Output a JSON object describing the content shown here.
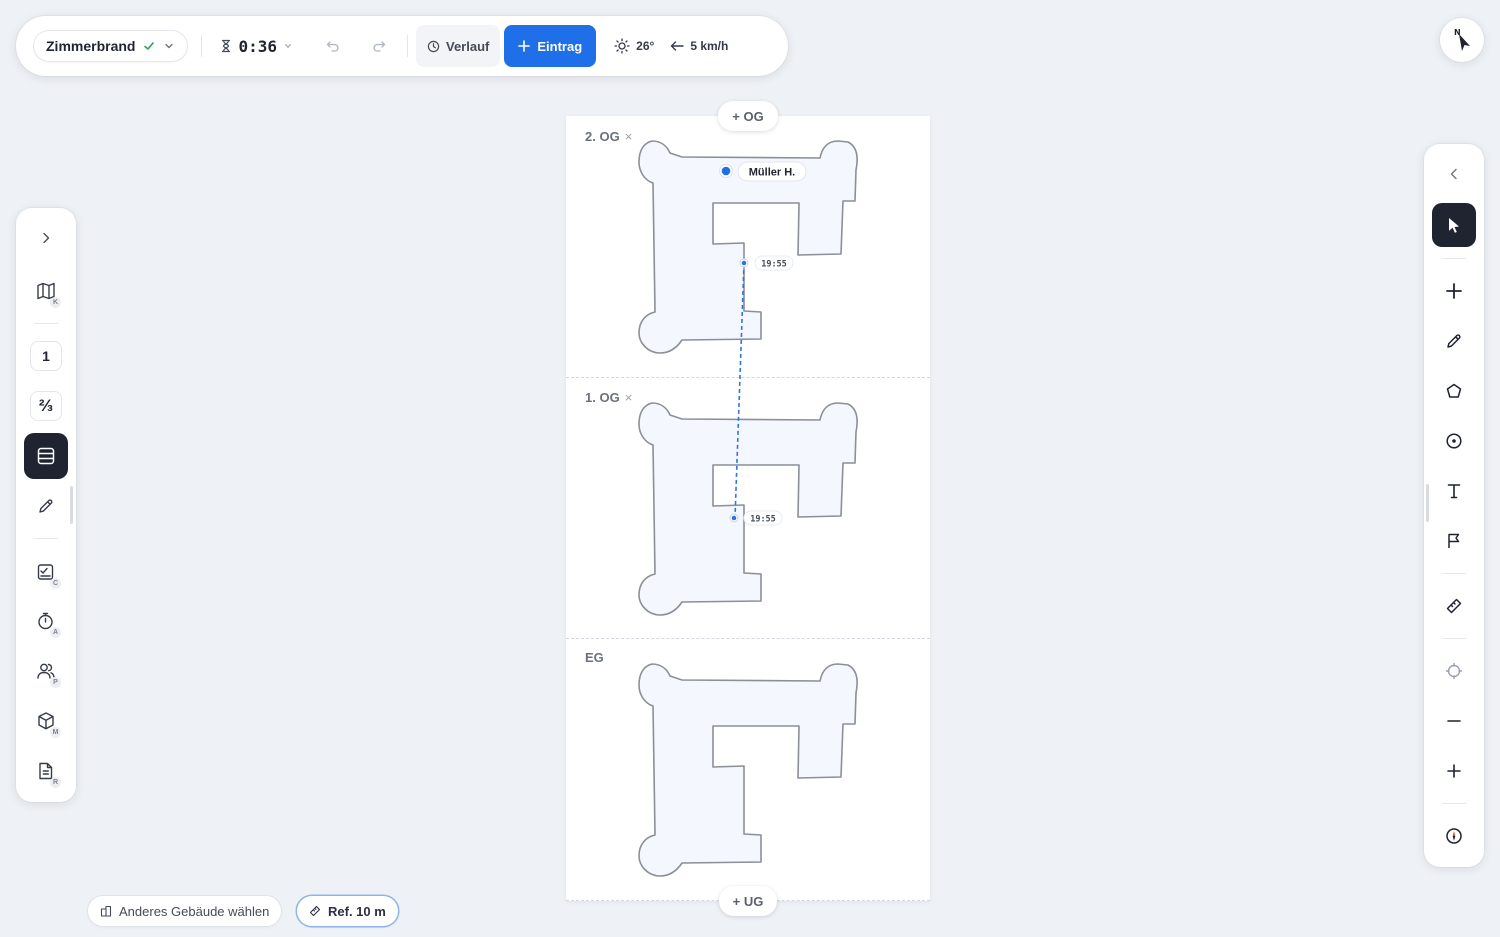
{
  "toolbar": {
    "scenario_name": "Zimmerbrand",
    "timer": "0:36",
    "history_label": "Verlauf",
    "entry_label": "Eintrag",
    "temperature": "26°",
    "wind": "5 km/h"
  },
  "compass": {
    "north_label": "N"
  },
  "sidebar_left": {
    "badges": {
      "map": "K",
      "checklist": "C",
      "timer": "A",
      "persons": "P",
      "material": "M",
      "report": "R"
    },
    "view_single": "1",
    "view_split": "⅔"
  },
  "floors": [
    {
      "label": "2. OG",
      "removable": true
    },
    {
      "label": "1. OG",
      "removable": true
    },
    {
      "label": "EG",
      "removable": false
    }
  ],
  "floor_controls": {
    "add_above": "+ OG",
    "add_below": "+ UG"
  },
  "markers": {
    "person": "Müller H.",
    "time_upper": "19:55",
    "time_lower": "19:55"
  },
  "bottom": {
    "building_label": "Anderes Gebäude wählen",
    "reference_label": "Ref. 10 m"
  },
  "colors": {
    "accent": "#1e6fe8",
    "dark": "#1f2430",
    "floor_fill": "#f4f7fd",
    "floor_stroke": "#8a8f98"
  }
}
